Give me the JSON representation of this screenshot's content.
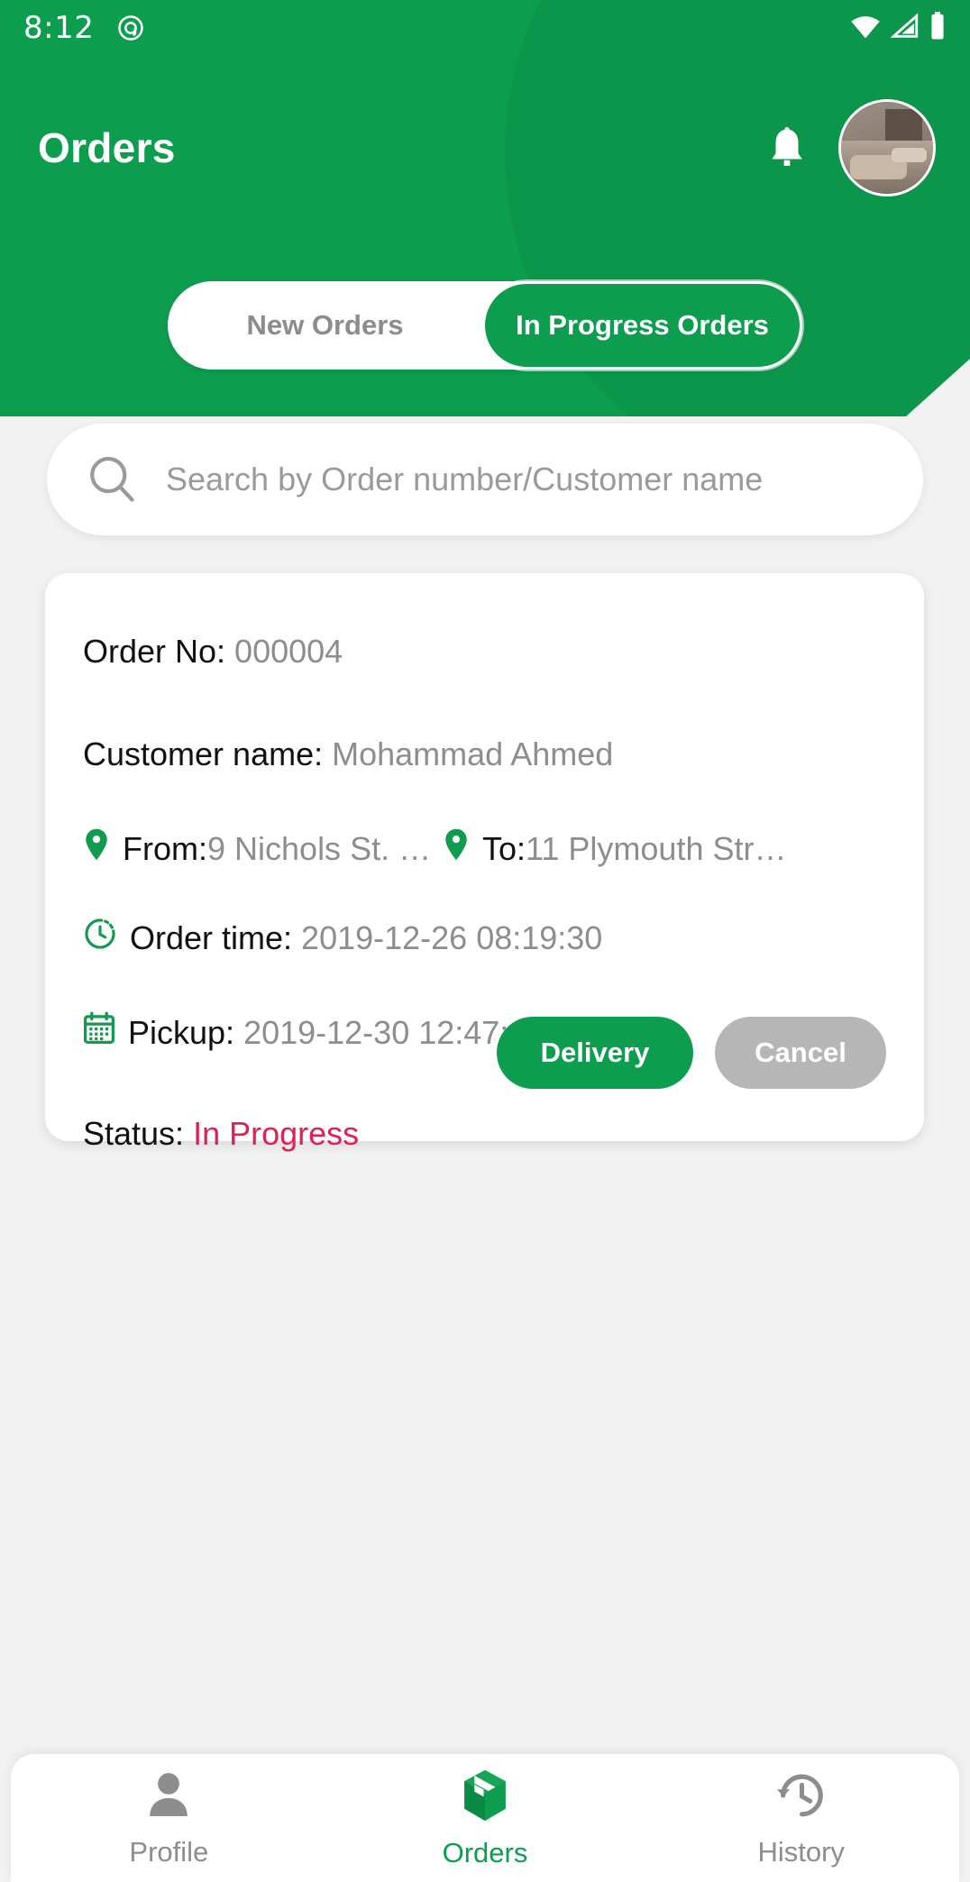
{
  "statusbar": {
    "time": "8:12",
    "app_icon": "at-circle-icon",
    "wifi_icon": "wifi-icon",
    "signal_icon": "cell-signal-icon",
    "battery_icon": "battery-full-icon"
  },
  "header": {
    "title": "Orders",
    "bell_icon": "bell-icon",
    "avatar": "user-avatar",
    "bg_color": "#0d9d4f"
  },
  "tabs": [
    {
      "label": "New Orders",
      "active": false
    },
    {
      "label": "In Progress Orders",
      "active": true
    }
  ],
  "search": {
    "icon": "search-icon",
    "placeholder": "Search by Order number/Customer name",
    "value": ""
  },
  "order": {
    "order_no_label": "Order No:",
    "order_no_value": "000004",
    "customer_label": "Customer name:",
    "customer_value": "Mohammad Ahmed",
    "from_label": "From:",
    "from_value": "9 Nichols St. N...",
    "to_label": "To:",
    "to_value": "11 Plymouth Stre...",
    "from_icon": "map-pin-icon",
    "to_icon": "map-pin-icon",
    "order_time_label": "Order time:",
    "order_time_value": "2019-12-26 08:19:30",
    "order_time_icon": "clock-icon",
    "pickup_label": "Pickup:",
    "pickup_value": "2019-12-30 12:47:17",
    "pickup_icon": "calendar-icon",
    "status_label": "Status:",
    "status_value": "In Progress",
    "status_color": "#e01f55",
    "delivery_button": "Delivery",
    "cancel_button": "Cancel"
  },
  "bottom_nav": [
    {
      "label": "Profile",
      "icon": "person-icon",
      "active": false
    },
    {
      "label": "Orders",
      "icon": "package-box-icon",
      "active": true
    },
    {
      "label": "History",
      "icon": "history-clock-icon",
      "active": false
    }
  ]
}
